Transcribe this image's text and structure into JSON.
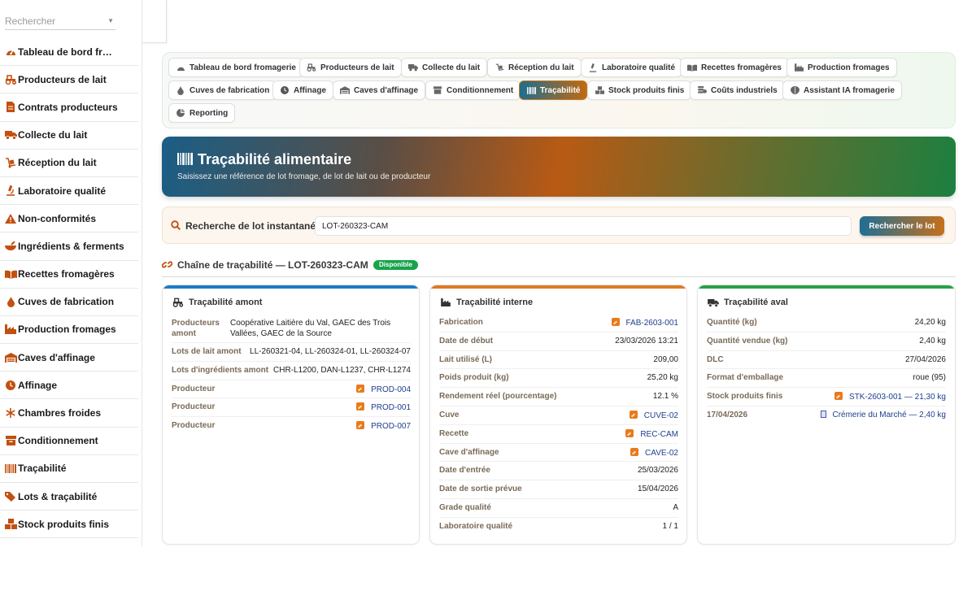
{
  "sidebar": {
    "search_placeholder": "Rechercher",
    "items": [
      {
        "label": "Tableau de bord fromagerie",
        "icon": "dashboard-icon"
      },
      {
        "label": "Producteurs de lait",
        "icon": "tractor-icon"
      },
      {
        "label": "Contrats producteurs",
        "icon": "contract-icon"
      },
      {
        "label": "Collecte du lait",
        "icon": "truck-icon"
      },
      {
        "label": "Réception du lait",
        "icon": "dolly-icon"
      },
      {
        "label": "Laboratoire qualité",
        "icon": "microscope-icon"
      },
      {
        "label": "Non-conformités",
        "icon": "warning-icon"
      },
      {
        "label": "Ingrédients & ferments",
        "icon": "mortar-icon"
      },
      {
        "label": "Recettes fromagères",
        "icon": "book-icon"
      },
      {
        "label": "Cuves de fabrication",
        "icon": "drop-icon"
      },
      {
        "label": "Production fromages",
        "icon": "industry-icon"
      },
      {
        "label": "Caves d'affinage",
        "icon": "warehouse-icon"
      },
      {
        "label": "Affinage",
        "icon": "clock-icon"
      },
      {
        "label": "Chambres froides",
        "icon": "snowflake-icon"
      },
      {
        "label": "Conditionnement",
        "icon": "box-icon"
      },
      {
        "label": "Traçabilité",
        "icon": "barcode-icon"
      },
      {
        "label": "Lots & traçabilité",
        "icon": "tags-icon"
      },
      {
        "label": "Stock produits finis",
        "icon": "boxes-icon"
      }
    ]
  },
  "tabs": [
    {
      "label": "Tableau de bord fromagerie",
      "icon": "dashboard-icon"
    },
    {
      "label": "Producteurs de lait",
      "icon": "tractor-icon"
    },
    {
      "label": "Collecte du lait",
      "icon": "truck-icon"
    },
    {
      "label": "Réception du lait",
      "icon": "dolly-icon"
    },
    {
      "label": "Laboratoire qualité",
      "icon": "microscope-icon"
    },
    {
      "label": "Recettes fromagères",
      "icon": "book-icon"
    },
    {
      "label": "Production fromages",
      "icon": "industry-icon"
    },
    {
      "label": "Cuves de fabrication",
      "icon": "drop-icon"
    },
    {
      "label": "Affinage",
      "icon": "clock-icon"
    },
    {
      "label": "Caves d'affinage",
      "icon": "warehouse-icon"
    },
    {
      "label": "Conditionnement",
      "icon": "box-icon"
    },
    {
      "label": "Traçabilité",
      "icon": "barcode-icon",
      "active": true
    },
    {
      "label": "Stock produits finis",
      "icon": "boxes-icon"
    },
    {
      "label": "Coûts industriels",
      "icon": "coins-icon"
    },
    {
      "label": "Assistant IA fromagerie",
      "icon": "brain-icon"
    },
    {
      "label": "Reporting",
      "icon": "pie-chart-icon"
    }
  ],
  "hero": {
    "title": "Traçabilité alimentaire",
    "subtitle": "Saisissez une référence de lot fromage, de lot de lait ou de producteur"
  },
  "search": {
    "label": "Recherche de lot instantanée",
    "value": "LOT-260323-CAM",
    "button": "Rechercher le lot"
  },
  "chain": {
    "title": "Chaîne de traçabilité — LOT-260323-CAM",
    "badge": "Disponible"
  },
  "colors": {
    "amont": "#1f7bc4",
    "interne": "#e07a1f",
    "aval": "#27a244",
    "badge": "#17a34a"
  },
  "cards": {
    "amont": {
      "title": "Traçabilité amont",
      "rows": [
        {
          "label": "Producteurs amont",
          "value": "Coopérative Laitière du Val, GAEC des Trois Vallées, GAEC de la Source"
        },
        {
          "label": "Lots de lait amont",
          "value": "LL-260321-04, LL-260324-01, LL-260324-07"
        },
        {
          "label": "Lots d'ingrédients amont",
          "value": "CHR-L1200, DAN-L1237, CHR-L1274"
        },
        {
          "label": "Producteur",
          "value": "PROD-004"
        },
        {
          "label": "Producteur",
          "value": "PROD-001"
        },
        {
          "label": "Producteur",
          "value": "PROD-007"
        }
      ]
    },
    "interne": {
      "title": "Traçabilité interne",
      "rows": [
        {
          "label": "Fabrication",
          "value": "FAB-2603-001"
        },
        {
          "label": "Date de début",
          "value": "23/03/2026 13:21"
        },
        {
          "label": "Lait utilisé (L)",
          "value": "209,00"
        },
        {
          "label": "Poids produit (kg)",
          "value": "25,20 kg"
        },
        {
          "label": "Rendement réel (pourcentage)",
          "value": "12.1 %"
        },
        {
          "label": "Cuve",
          "value": "CUVE-02"
        },
        {
          "label": "Recette",
          "value": "REC-CAM"
        },
        {
          "label": "Cave d'affinage",
          "value": "CAVE-02"
        },
        {
          "label": "Date d'entrée",
          "value": "25/03/2026"
        },
        {
          "label": "Date de sortie prévue",
          "value": "15/04/2026"
        },
        {
          "label": "Grade qualité",
          "value": "A"
        },
        {
          "label": "Laboratoire qualité",
          "value": "1 / 1"
        }
      ]
    },
    "aval": {
      "title": "Traçabilité aval",
      "rows": [
        {
          "label": "Quantité (kg)",
          "value": "24,20 kg"
        },
        {
          "label": "Quantité vendue (kg)",
          "value": "2,40 kg"
        },
        {
          "label": "DLC",
          "value": "27/04/2026"
        },
        {
          "label": "Format d'emballage",
          "value": "roue (95)"
        },
        {
          "label": "Stock produits finis",
          "value": "STK-2603-001 — 21,30 kg"
        },
        {
          "label": "17/04/2026",
          "value": "Crémerie du Marché — 2,40 kg"
        }
      ]
    }
  }
}
